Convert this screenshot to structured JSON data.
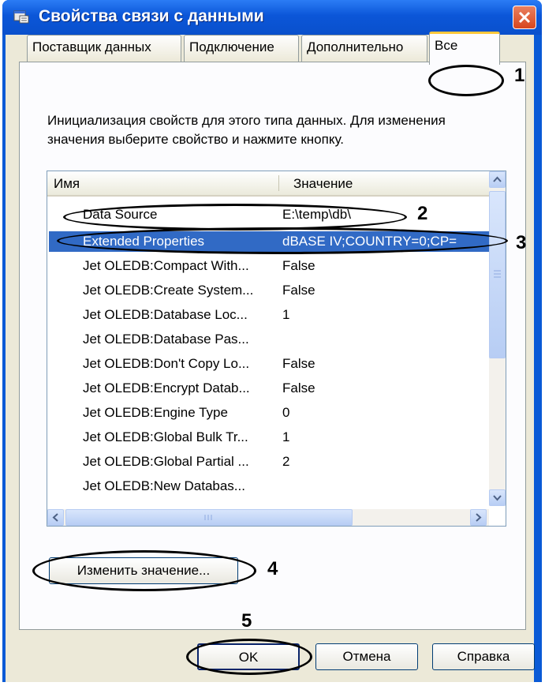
{
  "window": {
    "title": "Свойства связи с данными"
  },
  "tabs": [
    {
      "label": "Поставщик данных"
    },
    {
      "label": "Подключение"
    },
    {
      "label": "Дополнительно"
    },
    {
      "label": "Все"
    }
  ],
  "description": "Инициализация свойств для этого типа данных. Для изменения значения выберите свойство и нажмите кнопку.",
  "list": {
    "col_name": "Имя",
    "col_value": "Значение",
    "rows": [
      {
        "name": "Data Source",
        "value": "E:\\temp\\db\\"
      },
      {
        "name": "Extended Properties",
        "value": "dBASE IV;COUNTRY=0;CP="
      },
      {
        "name": "Jet OLEDB:Compact With...",
        "value": "False"
      },
      {
        "name": "Jet OLEDB:Create System...",
        "value": "False"
      },
      {
        "name": "Jet OLEDB:Database Loc...",
        "value": "1"
      },
      {
        "name": "Jet OLEDB:Database Pas...",
        "value": ""
      },
      {
        "name": "Jet OLEDB:Don't Copy Lo...",
        "value": "False"
      },
      {
        "name": "Jet OLEDB:Encrypt Datab...",
        "value": "False"
      },
      {
        "name": "Jet OLEDB:Engine Type",
        "value": "0"
      },
      {
        "name": "Jet OLEDB:Global Bulk Tr...",
        "value": "1"
      },
      {
        "name": "Jet OLEDB:Global Partial ...",
        "value": "2"
      },
      {
        "name": "Jet OLEDB:New Databas...",
        "value": ""
      }
    ]
  },
  "buttons": {
    "edit": "Изменить значение...",
    "ok": "OK",
    "cancel": "Отмена",
    "help": "Справка"
  },
  "callouts": {
    "n1": "1",
    "n2": "2",
    "n3": "3",
    "n4": "4",
    "n5": "5"
  },
  "colors": {
    "titlebar": "#0a5ad6",
    "selection": "#316ac5",
    "dialog": "#ece9d8"
  }
}
